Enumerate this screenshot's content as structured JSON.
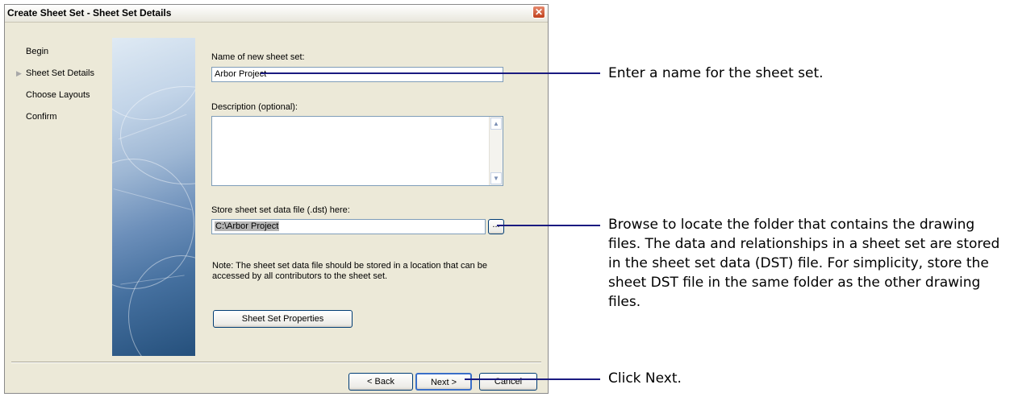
{
  "dialog": {
    "title": "Create Sheet Set - Sheet Set Details",
    "close_glyph": "✕",
    "steps": [
      {
        "label": "Begin",
        "current": false
      },
      {
        "label": "Sheet Set Details",
        "current": true
      },
      {
        "label": "Choose Layouts",
        "current": false
      },
      {
        "label": "Confirm",
        "current": false
      }
    ],
    "current_step_marker": "▶",
    "name_label": "Name of new sheet set:",
    "name_value": "Arbor Project",
    "description_label": "Description (optional):",
    "description_value": "",
    "store_label": "Store sheet set data file (.dst) here:",
    "store_value": "C:\\Arbor Project",
    "browse_label": "...",
    "note": "Note: The sheet set data file should be stored in a location that can be accessed by all contributors to the sheet set.",
    "properties_button": "Sheet Set Properties",
    "back_button": "< Back",
    "next_button": "Next >",
    "cancel_button": "Cancel",
    "scroll_up_glyph": "▲",
    "scroll_down_glyph": "▼"
  },
  "callouts": {
    "name": "Enter a name for the sheet set.",
    "browse": "Browse to locate the folder that contains the drawing files. The data and relationships in a sheet set are stored in the sheet set data (DST) file. For simplicity, store the sheet DST file in the same folder as the other drawing files.",
    "next": "Click Next."
  },
  "colors": {
    "dialog_bg": "#ece9d8",
    "callout_line": "#1a1a80",
    "field_border": "#7f9db9"
  }
}
